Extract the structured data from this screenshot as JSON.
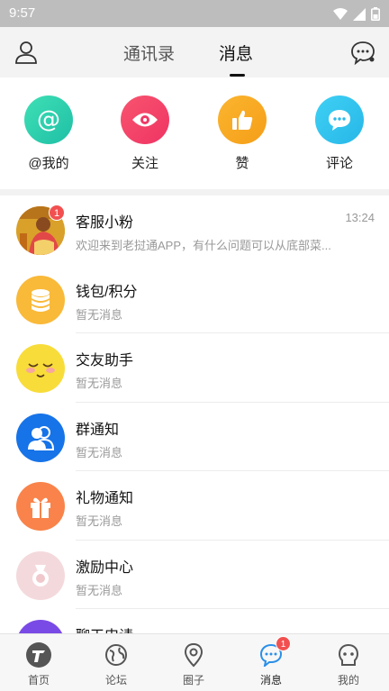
{
  "status_bar": {
    "time": "9:57"
  },
  "top_nav": {
    "tabs": [
      {
        "label": "通讯录",
        "active": false
      },
      {
        "label": "消息",
        "active": true
      }
    ]
  },
  "quick_actions": [
    {
      "label": "@我的",
      "icon": "at-icon",
      "color": "#2ecfa9"
    },
    {
      "label": "关注",
      "icon": "eye-icon",
      "color": "#f4436c"
    },
    {
      "label": "赞",
      "icon": "thumbs-up-icon",
      "color": "#f7a71e"
    },
    {
      "label": "评论",
      "icon": "comment-icon",
      "color": "#33c3ee"
    }
  ],
  "messages": [
    {
      "title": "客服小粉",
      "subtitle": "欢迎来到老挝通APP，有什么问题可以从底部菜...",
      "time": "13:24",
      "badge": "1",
      "icon": "customer-service-photo"
    },
    {
      "title": "钱包/积分",
      "subtitle": "暂无消息",
      "icon": "coins-icon",
      "color": "#f9b939"
    },
    {
      "title": "交友助手",
      "subtitle": "暂无消息",
      "icon": "smiley-face-icon",
      "color": "#f8dc3a"
    },
    {
      "title": "群通知",
      "subtitle": "暂无消息",
      "icon": "group-icon",
      "color": "#1773e8"
    },
    {
      "title": "礼物通知",
      "subtitle": "暂无消息",
      "icon": "gift-icon",
      "color": "#f9834a"
    },
    {
      "title": "激励中心",
      "subtitle": "暂无消息",
      "icon": "medal-icon",
      "color": "#f4d9dc"
    },
    {
      "title": "聊天申请",
      "subtitle": "",
      "icon": "chat-request-icon",
      "color": "#7a4ae6"
    }
  ],
  "tab_bar": [
    {
      "label": "首页",
      "icon": "home-logo-icon",
      "active": false
    },
    {
      "label": "论坛",
      "icon": "globe-icon",
      "active": false
    },
    {
      "label": "圈子",
      "icon": "location-pin-icon",
      "active": false
    },
    {
      "label": "消息",
      "icon": "message-icon",
      "active": true,
      "badge": "1"
    },
    {
      "label": "我的",
      "icon": "profile-icon",
      "active": false
    }
  ]
}
